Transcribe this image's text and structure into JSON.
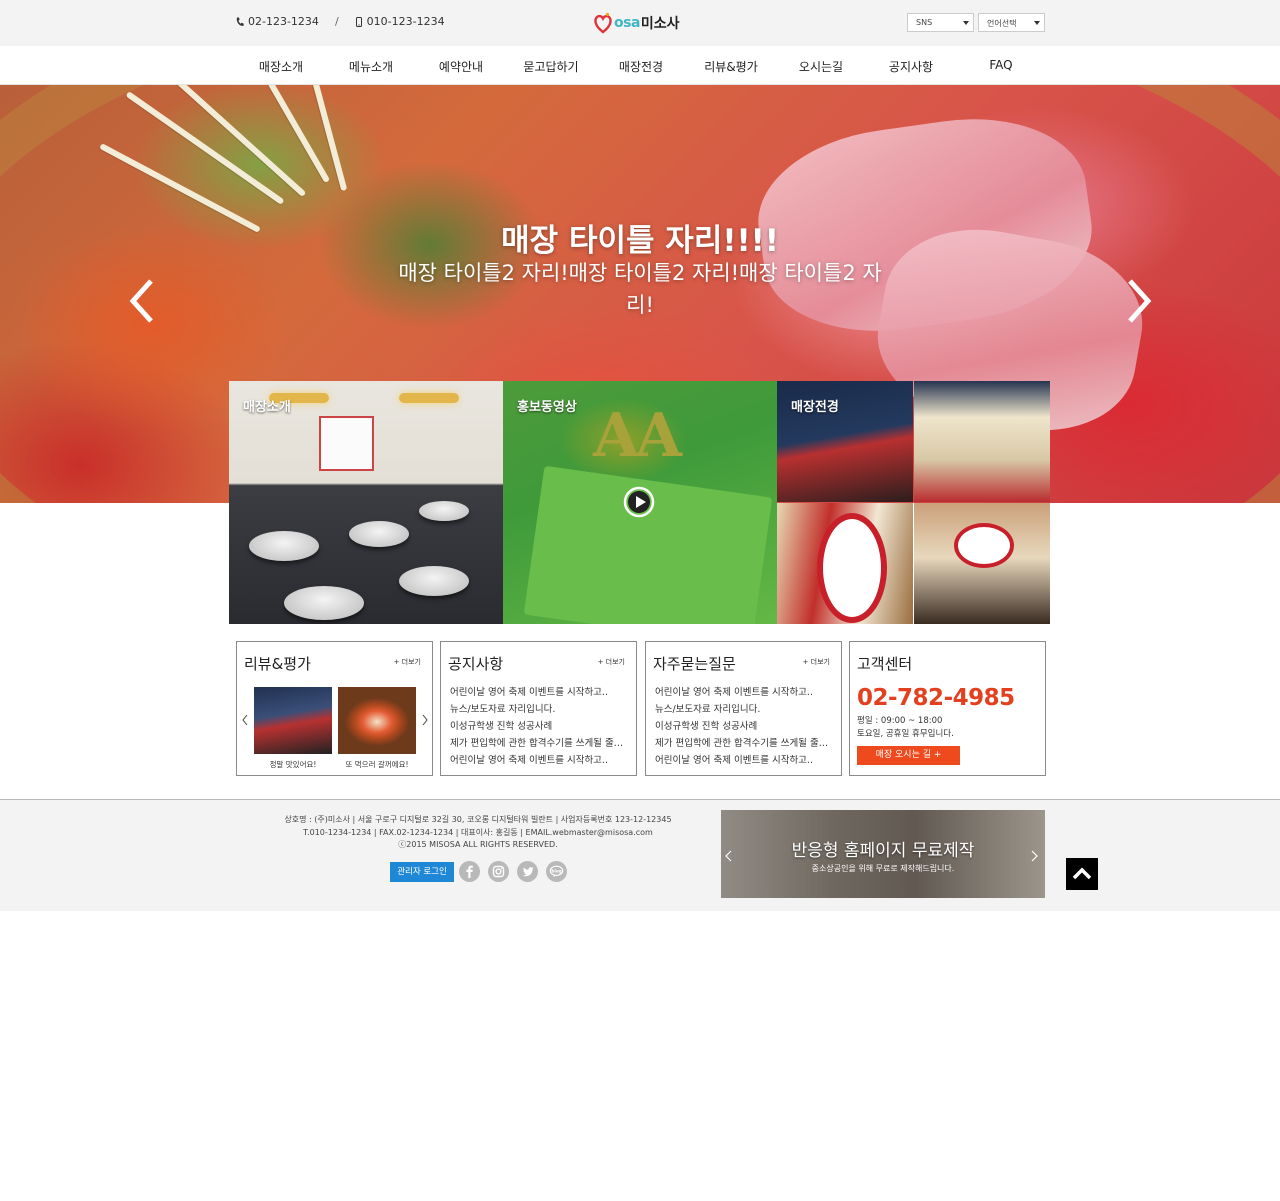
{
  "header": {
    "phone1": "02-123-1234",
    "separator": "/",
    "phone2": "010-123-1234",
    "logo_en": "osa",
    "logo_ko": "미소사",
    "sns_select": "SNS",
    "lang_select": "언어선택"
  },
  "nav": {
    "items": [
      "매장소개",
      "메뉴소개",
      "예약안내",
      "묻고답하기",
      "매장전경",
      "리뷰&평가",
      "오시는길",
      "공지사항",
      "FAQ"
    ]
  },
  "hero": {
    "title": "매장 타이틀 자리!!!!",
    "subtitle": "매장 타이틀2 자리!매장 타이틀2 자리!매장 타이틀2 자리!"
  },
  "gallery": {
    "store_label": "매장소개",
    "video_label": "홍보동영상",
    "scene_label": "매장전경"
  },
  "review": {
    "title": "리뷰&평가",
    "more": "+ 더보기",
    "items": [
      {
        "caption": "정말 맛있어요!"
      },
      {
        "caption": "또 먹으러 갈꺼에요!"
      }
    ]
  },
  "notice": {
    "title": "공지사항",
    "more": "+ 더보기",
    "items": [
      "어린이날 영어 축제 이벤트를 시작하고..",
      "뉴스/보도자료 자리입니다.",
      "이성규학생 진학 성공사례",
      "제가 편입학에 관한 합격수기를 쓰게될 줄…",
      "어린이날 영어 축제 이벤트를 시작하고.."
    ]
  },
  "faq": {
    "title": "자주묻는질문",
    "more": "+ 더보기",
    "items": [
      "어린이날 영어 축제 이벤트를 시작하고..",
      "뉴스/보도자료 자리입니다.",
      "이성규학생 진학 성공사례",
      "제가 편입학에 관한 합격수기를 쓰게될 줄…",
      "어린이날 영어 축제 이벤트를 시작하고.."
    ]
  },
  "cs": {
    "title": "고객센터",
    "phone": "02-782-4985",
    "hours1": "평일 : 09:00 ~ 18:00",
    "hours2": "토요일, 공휴일 휴무입니다.",
    "button": "매장 오시는 길 +"
  },
  "footer": {
    "line1": "상호명 : (주)미소사 | 서울 구로구 디지털로 32길 30, 코오롱 디지털타워 빌란트 | 사업자등록번호 123-12-12345",
    "line2": "T.010-1234-1234 | FAX.02-1234-1234 | 대표이사: 홍길동 | EMAIL.webmaster@misosa.com",
    "line3": "ⓒ2015 MISOSA ALL RIGHTS RESERVED.",
    "admin_login": "관리자 로그인",
    "banner_title": "반응형 홈페이지 무료제작",
    "banner_sub": "중소상공인을 위해 무료로 제작해드립니다."
  },
  "colors": {
    "accent": "#e3401f",
    "button_orange": "#ee4a1e",
    "admin_blue": "#1e88d6",
    "logo_teal": "#3fb6c6"
  }
}
